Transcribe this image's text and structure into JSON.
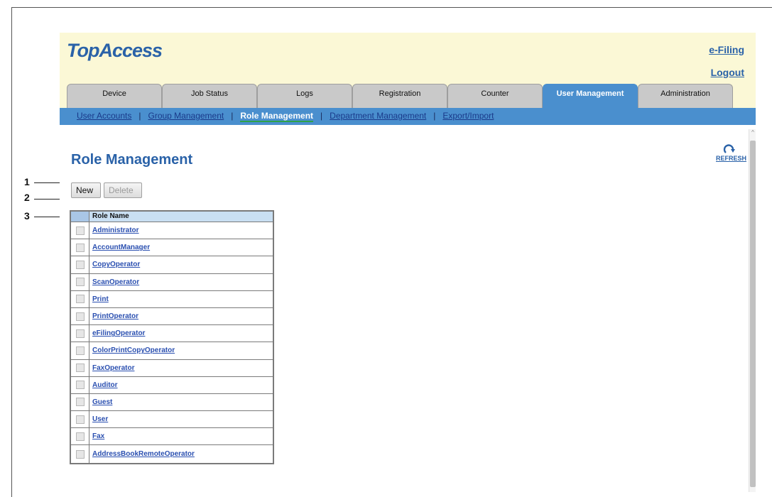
{
  "app": {
    "logo": "TopAccess",
    "links": {
      "efiling": "e-Filing",
      "logout": "Logout"
    },
    "tabs": [
      "Device",
      "Job Status",
      "Logs",
      "Registration",
      "Counter",
      "User Management",
      "Administration"
    ],
    "active_tab": "User Management",
    "subnav": [
      "User Accounts",
      "Group Management",
      "Role Management",
      "Department Management",
      "Export/Import"
    ],
    "active_subnav": "Role Management",
    "refresh_label": "REFRESH"
  },
  "page": {
    "title": "Role Management",
    "buttons": {
      "new": "New",
      "delete": "Delete"
    }
  },
  "table": {
    "header": "Role Name",
    "rows": [
      "Administrator",
      "AccountManager",
      "CopyOperator",
      "ScanOperator",
      "Print",
      "PrintOperator",
      "eFilingOperator",
      "ColorPrintCopyOperator",
      "FaxOperator",
      "Auditor",
      "Guest",
      "User",
      "Fax",
      "AddressBookRemoteOperator"
    ]
  },
  "callouts": [
    "1",
    "2",
    "3"
  ],
  "colors": {
    "brand_blue": "#2a62a8",
    "nav_blue": "#4a8fce",
    "header_bg": "#fbf8d6",
    "link": "#2a4fb0"
  }
}
